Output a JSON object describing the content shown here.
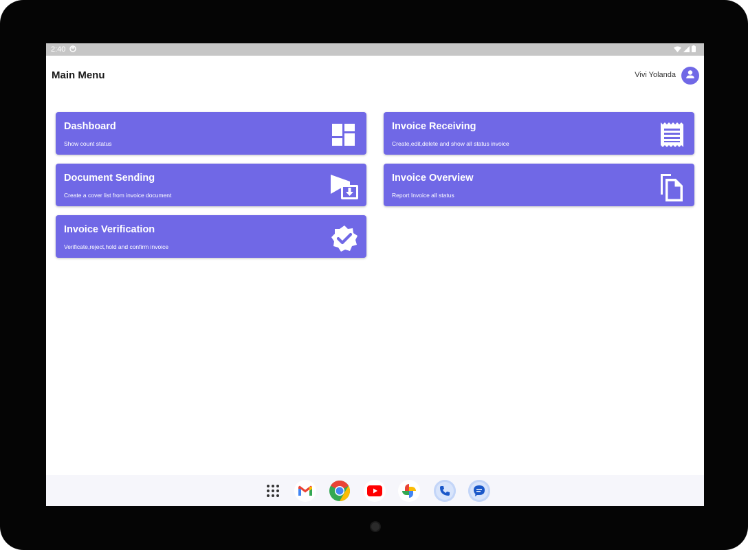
{
  "status_bar": {
    "time": "2:40",
    "icons": [
      "circle-status-icon",
      "wifi-icon",
      "signal-icon",
      "battery-icon"
    ]
  },
  "header": {
    "title": "Main Menu",
    "user_name": "Vivi Yolanda",
    "avatar_icon": "person-icon"
  },
  "menu": {
    "accent_color": "#7068e6",
    "items": [
      {
        "title": "Dashboard",
        "subtitle": "Show count status",
        "icon": "dashboard-icon"
      },
      {
        "title": "Invoice Receiving",
        "subtitle": "Create,edit,delete and show all status invoice",
        "icon": "receipt-icon"
      },
      {
        "title": "Document Sending",
        "subtitle": "Create a cover list from invoice document",
        "icon": "document-send-icon"
      },
      {
        "title": "Invoice Overview",
        "subtitle": "Report Invoice all status",
        "icon": "copy-documents-icon"
      },
      {
        "title": "Invoice Verification",
        "subtitle": "Verificate,reject,hold and confirm invoice",
        "icon": "verified-badge-icon"
      }
    ]
  },
  "dock": {
    "apps": [
      "app-drawer-icon",
      "gmail-icon",
      "chrome-icon",
      "youtube-icon",
      "photos-icon",
      "phone-icon",
      "messages-icon"
    ]
  }
}
